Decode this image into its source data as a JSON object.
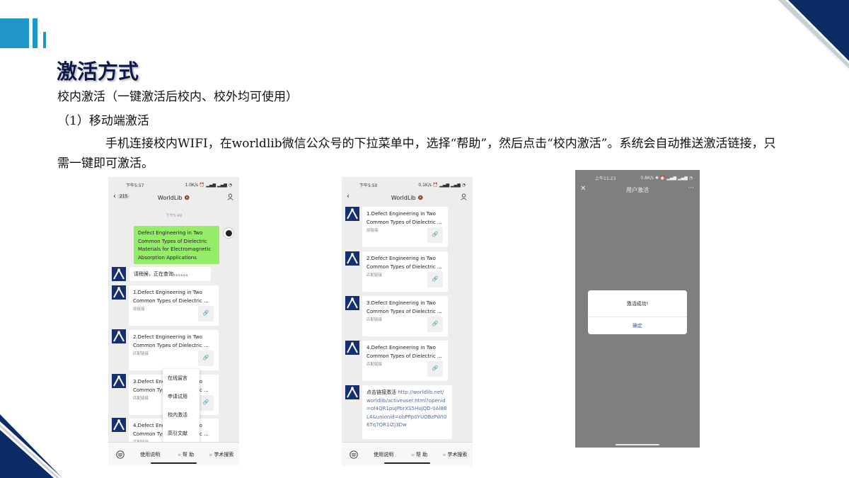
{
  "slide": {
    "title": "激活方式",
    "subtitle": "校内激活（一键激活后校内、校外均可使用）",
    "section": "（1）移动端激活",
    "paragraph": "手机连接校内WIFI，在worldlib微信公众号的下拉菜单中，选择“帮助”，然后点击“校内激活”。系统会自动推送激活链接，只需一键即可激活。"
  },
  "phone1": {
    "status_time": "下午5:57",
    "status_right": "1.0K/s ⏰ ▂▄▆ ▂▄▆ ◔",
    "back_count": "215",
    "title": "WorldLib",
    "timestamp": "下午5:49",
    "user_message": "Defect Engineering in Two Common Types of Dielectric Materials for Electromagnetic Absorption Applications",
    "reply": "请稍候，正在查询。。。。。。",
    "cards": [
      {
        "text": "1.Defect Engineering in Two Common Types of Dielectric ...",
        "tag": "原链接"
      },
      {
        "text": "2.Defect Engineering in Two Common Types of Dielectric ...",
        "tag": "匹配链接"
      },
      {
        "text": "3.Defect Engineering in Two Common Types of Dielectric ...",
        "tag": "匹配链接"
      },
      {
        "text": "4.Defect Engineering in Two Common Types of Dielectric ...",
        "tag": "匹配链接"
      }
    ],
    "menu": [
      "在线留言",
      "申请试用",
      "校内激活",
      "高引文献"
    ],
    "bottom": [
      "使用说明",
      "帮 助",
      "学术搜索"
    ]
  },
  "phone2": {
    "status_time": "下午5:50",
    "status_right": "0.1K/s ⏰ ▂▄▆ ▂▄▆ ◔",
    "title": "WorldLib",
    "cards": [
      {
        "text": "1.Defect Engineering in Two Common Types of Dielectric ...",
        "tag": "原链接"
      },
      {
        "text": "2.Defect Engineering in Two Common Types of Dielectric ...",
        "tag": "匹配链接"
      },
      {
        "text": "3.Defect Engineering in Two Common Types of Dielectric ...",
        "tag": "匹配链接"
      },
      {
        "text": "4.Defect Engineering in Two Common Types of Dielectric ...",
        "tag": "匹配链接"
      }
    ],
    "activation_prefix": "点击链接激活 ",
    "activation_url": "http://worldlib.net/worldlib/activeuser.html?openid=of4QR1puJPbrXS5HujQD-0Al8BL4&unionid=obPPp0YUOBzPWt06Tq7OR1iZj3Dw",
    "bottom": [
      "使用说明",
      "帮 助",
      "学术搜索"
    ]
  },
  "phone3": {
    "status_time": "上午11:23",
    "status_right": "0.8K/s ✱ ⏰ ▂▄▆ ▂▄▆ ◔",
    "close_icon": "✕",
    "title": "用户激活",
    "more_icon": "···",
    "dialog_message": "激活成功!",
    "dialog_confirm": "确定"
  },
  "colors": {
    "accent_blue": "#2196c9",
    "navy": "#0b1a4a",
    "wechat_green": "#95ec69"
  }
}
